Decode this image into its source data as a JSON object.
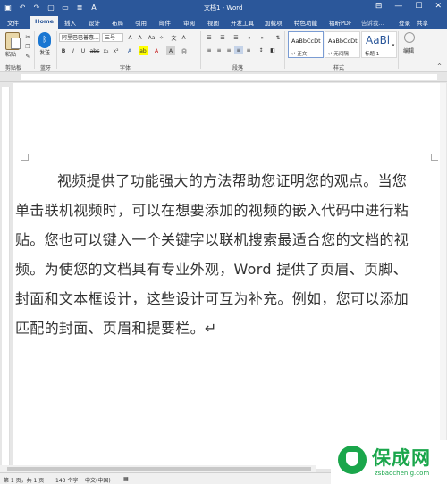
{
  "window": {
    "title": "文档1 - Word",
    "controls": [
      "⊟",
      "—",
      "☐",
      "✕"
    ]
  },
  "quick_access": [
    "save-icon",
    "undo-icon",
    "redo-icon"
  ],
  "tabs": [
    "文件",
    "Home",
    "插入",
    "设计",
    "布局",
    "引用",
    "邮件",
    "审阅",
    "视图",
    "开发工具",
    "加载项",
    "特色功能",
    "福昕PDF"
  ],
  "tell_me": "告诉我...",
  "login": "登录",
  "share": "共享",
  "ribbon": {
    "clipboard": {
      "paste": "粘贴",
      "label": "剪贴板"
    },
    "bluetooth": {
      "send": "发送...",
      "label": "蓝牙"
    },
    "font": {
      "name": "阿里巴巴普惠...",
      "size": "三号",
      "label": "字体"
    },
    "paragraph": {
      "label": "段落"
    },
    "styles": {
      "items": [
        {
          "sample": "AaBbCcDt",
          "name": "↵ 正文"
        },
        {
          "sample": "AaBbCcDt",
          "name": "↵ 无间隔"
        },
        {
          "sample": "AaBl",
          "name": "标题 1"
        }
      ],
      "label": "样式"
    },
    "editing": {
      "label": "编辑"
    }
  },
  "document": {
    "paragraph": "视频提供了功能强大的方法帮助您证明您的观点。当您单击联机视频时，可以在想要添加的视频的嵌入代码中进行粘贴。您也可以键入一个关键字以联机搜索最适合您的文档的视频。为使您的文档具有专业外观，Word 提供了页眉、页脚、封面和文本框设计，这些设计可互为补充。例如，您可以添加匹配的封面、页眉和提要栏。↵"
  },
  "status": {
    "page": "第 1 页，共 1 页",
    "words": "143 个字",
    "language": "中文(中国)"
  },
  "watermark": {
    "brand": "保成网",
    "url": "zsbaochen g.com"
  }
}
